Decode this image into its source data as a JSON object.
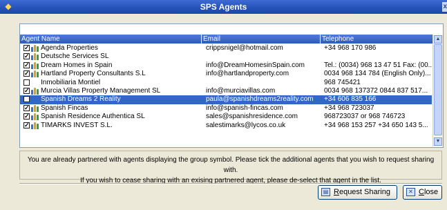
{
  "window": {
    "title": "SPS Agents",
    "close_glyph": "x"
  },
  "table": {
    "columns": [
      "Agent Name",
      "Email",
      "Telephone"
    ],
    "rows": [
      {
        "checked": true,
        "group": true,
        "name": "Agenda Properties",
        "email": "crippsnigel@hotmail.com",
        "tel": "+34 968 170 986",
        "selected": false
      },
      {
        "checked": true,
        "group": true,
        "name": "Deutsche Services SL",
        "email": "",
        "tel": "",
        "selected": false
      },
      {
        "checked": true,
        "group": true,
        "name": "Dream Homes in Spain",
        "email": "info@DreamHomesinSpain.com",
        "tel": "Tel.: (0034) 968 13 47 51 Fax: (00...",
        "selected": false
      },
      {
        "checked": true,
        "group": true,
        "name": "Hartland Property Consultants S.L",
        "email": "info@hartlandproperty.com",
        "tel": "0034 968 134 784 (English  Only)...",
        "selected": false
      },
      {
        "checked": false,
        "group": false,
        "name": "Inmobiliaria Montiel",
        "email": "",
        "tel": "968 745421",
        "selected": false
      },
      {
        "checked": true,
        "group": true,
        "name": "Murcia Villas Property Management SL",
        "email": "info@murciavillas.com",
        "tel": "0034 968 137372  0844 837 517...",
        "selected": false
      },
      {
        "checked": false,
        "group": false,
        "name": "Spanish Dreams 2 Reality",
        "email": "paula@spanishdreams2reality.com",
        "tel": "+34 606 835 166",
        "selected": true
      },
      {
        "checked": true,
        "group": true,
        "name": "Spanish Fincas",
        "email": "info@spanish-fincas.com",
        "tel": "+34 968 723037",
        "selected": false
      },
      {
        "checked": true,
        "group": true,
        "name": "Spanish Residence Authentica SL",
        "email": "sales@spanishresidence.com",
        "tel": "968723037 or 968 746723",
        "selected": false
      },
      {
        "checked": true,
        "group": true,
        "name": "TIMARKS INVEST S.L.",
        "email": "salestimarks@lycos.co.uk",
        "tel": "+34 968 153 257  +34 650 143 5...",
        "selected": false
      }
    ]
  },
  "message": {
    "line1": "You are already partnered with agents displaying the group symbol. Please tick the additional agents that you wish to request sharing with.",
    "line2": "If you wish to cease sharing with an exising partnered agent, please de-select that agent in the list."
  },
  "buttons": {
    "request_first": "R",
    "request_rest": "equest Sharing",
    "close_first": "C",
    "close_rest": "lose"
  },
  "colors": {
    "title_bar": "#2452b8",
    "header": "#3d6bd3",
    "selection": "#3168c6",
    "dialog_bg": "#ece9d8"
  },
  "icons": {
    "app": "app-icon",
    "group": "group-icon",
    "checkbox": "checkbox-icon"
  }
}
